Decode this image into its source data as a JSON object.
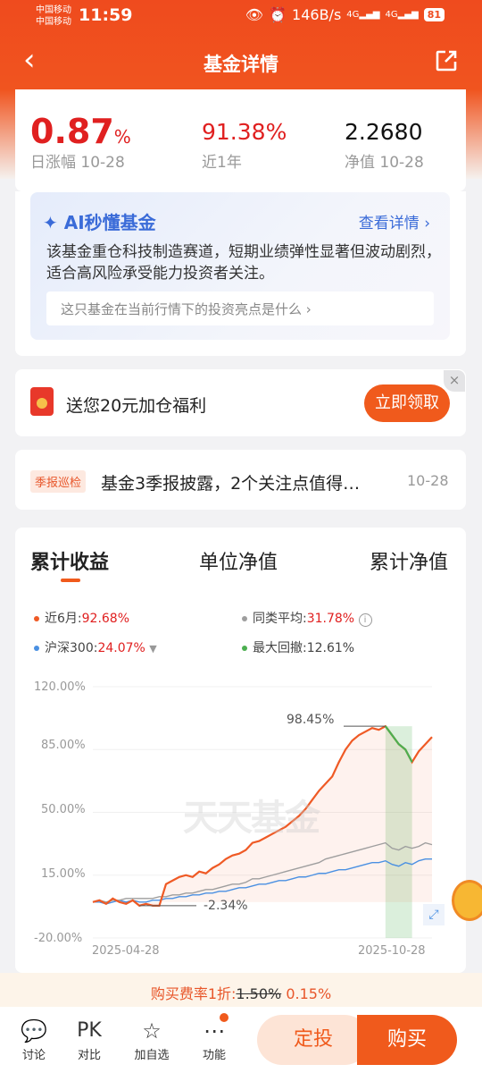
{
  "status": {
    "carrier1": "中国移动",
    "carrier2": "中国移动",
    "time": "11:59",
    "speed": "146B/s",
    "net1": "4G",
    "net2": "4G",
    "battery": "81"
  },
  "nav": {
    "title": "基金详情"
  },
  "metrics": {
    "daily_value": "0.87",
    "daily_unit": "%",
    "daily_label": "日涨幅 10-28",
    "year_value": "91.38%",
    "year_label": "近1年",
    "nav_value": "2.2680",
    "nav_label": "净值 10-28"
  },
  "ai": {
    "title": "AI秒懂基金",
    "detail_link": "查看详情",
    "text": "该基金重仓科技制造赛道，短期业绩弹性显著但波动剧烈，适合高风险承受能力投资者关注。",
    "question": "这只基金在当前行情下的投资亮点是什么"
  },
  "promo": {
    "text": "送您20元加仓福利",
    "button": "立即领取"
  },
  "news": {
    "tag": "季报巡检",
    "headline": "基金3季报披露，2个关注点值得…",
    "date": "10-28"
  },
  "chart_tabs": [
    "累计收益",
    "单位净值",
    "累计净值"
  ],
  "legend": {
    "fund_label": "近6月:",
    "fund_value": "92.68%",
    "peer_label": "同类平均:",
    "peer_value": "31.78%",
    "index_label": "沪深300:",
    "index_value": "24.07%",
    "dd_label": "最大回撤:",
    "dd_value": "12.61%"
  },
  "colors": {
    "fund": "#ef5a25",
    "peer": "#9e9e9e",
    "index": "#4a90e2",
    "drawdown": "#4caf50",
    "accent": "#f05a1c"
  },
  "watermark": "天天基金",
  "chart_data": {
    "type": "line",
    "x_start": "2025-04-28",
    "x_end": "2025-10-28",
    "y_ticks": [
      "120.00%",
      "85.00%",
      "50.00%",
      "15.00%",
      "-20.00%"
    ],
    "ylim": [
      -20,
      120
    ],
    "x_ticks": [
      "2025-04-28",
      "2025-10-28"
    ],
    "annotations": {
      "max_label": "98.45%",
      "min_label": "-2.34%"
    },
    "series": [
      {
        "name": "近6月",
        "values": [
          0,
          1,
          -1,
          2,
          0,
          -1,
          1,
          -2,
          -1,
          -2,
          -2,
          10,
          12,
          14,
          15,
          14,
          17,
          16,
          19,
          21,
          24,
          26,
          27,
          29,
          33,
          34,
          36,
          38,
          40,
          42,
          45,
          48,
          52,
          57,
          62,
          66,
          70,
          78,
          85,
          90,
          93,
          95,
          97,
          96,
          98,
          93,
          88,
          85,
          78,
          84,
          88,
          92
        ]
      },
      {
        "name": "同类平均",
        "values": [
          0,
          1,
          0,
          1,
          1,
          2,
          2,
          2,
          2,
          2,
          3,
          3,
          4,
          4,
          5,
          5,
          6,
          7,
          7,
          8,
          9,
          10,
          10,
          11,
          13,
          13,
          14,
          15,
          16,
          17,
          18,
          19,
          20,
          21,
          22,
          24,
          25,
          26,
          27,
          28,
          29,
          30,
          31,
          32,
          33,
          30,
          29,
          31,
          30,
          31,
          33,
          32
        ]
      },
      {
        "name": "沪深300",
        "values": [
          0,
          0,
          -1,
          0,
          1,
          0,
          1,
          0,
          0,
          1,
          1,
          2,
          2,
          3,
          3,
          4,
          4,
          5,
          5,
          6,
          6,
          7,
          8,
          8,
          9,
          10,
          10,
          11,
          12,
          12,
          13,
          14,
          14,
          15,
          16,
          16,
          17,
          18,
          18,
          19,
          20,
          21,
          22,
          22,
          23,
          21,
          20,
          22,
          21,
          23,
          24,
          24
        ]
      }
    ]
  }
}
